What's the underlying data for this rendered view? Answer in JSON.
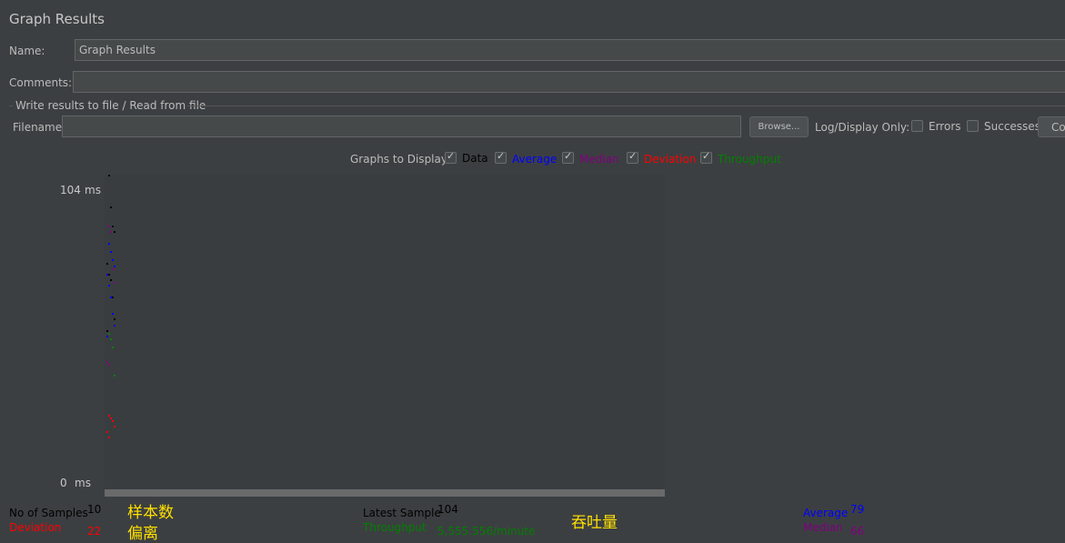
{
  "header": {
    "title": "Graph Results"
  },
  "name_field": {
    "label": "Name:",
    "value": "Graph Results"
  },
  "comments_field": {
    "label": "Comments:",
    "value": ""
  },
  "file_group": {
    "title": "Write results to file / Read from file",
    "filename_label": "Filename",
    "filename_value": "",
    "browse_label": "Browse...",
    "log_display_label": "Log/Display Only:",
    "errors_label": "Errors",
    "successes_label": "Successes",
    "configure_label": "Co"
  },
  "graphs": {
    "label": "Graphs to Display",
    "options": [
      {
        "label": "Data",
        "checked": true,
        "color": "#000000"
      },
      {
        "label": "Average",
        "checked": true,
        "color": "#0000ff"
      },
      {
        "label": "Median",
        "checked": true,
        "color": "#800080"
      },
      {
        "label": "Deviation",
        "checked": true,
        "color": "#ff0000"
      },
      {
        "label": "Throughput",
        "checked": true,
        "color": "#008000"
      }
    ]
  },
  "chart_data": {
    "type": "scatter",
    "ylabel_top": "104",
    "ylabel_bottom": "0",
    "y_unit": "ms",
    "ylim": [
      0,
      104
    ],
    "series": [
      {
        "name": "Data",
        "color": "#000000",
        "points": [
          [
            1,
            110
          ],
          [
            2,
            98
          ],
          [
            3,
            91
          ],
          [
            4,
            89
          ],
          [
            5,
            78
          ],
          [
            6,
            74
          ],
          [
            7,
            72
          ],
          [
            8,
            66
          ],
          [
            9,
            58
          ],
          [
            10,
            54
          ]
        ]
      },
      {
        "name": "Average",
        "color": "#0000ff",
        "points": [
          [
            1,
            85
          ],
          [
            2,
            82
          ],
          [
            3,
            79
          ],
          [
            4,
            77
          ],
          [
            5,
            74
          ],
          [
            6,
            70
          ],
          [
            7,
            66
          ],
          [
            8,
            60
          ],
          [
            9,
            56
          ],
          [
            10,
            52
          ]
        ]
      },
      {
        "name": "Median",
        "color": "#800080",
        "points": [
          [
            1,
            91
          ],
          [
            2,
            89
          ],
          [
            3,
            76
          ],
          [
            4,
            71
          ],
          [
            5,
            43
          ],
          [
            6,
            42
          ]
        ]
      },
      {
        "name": "Deviation",
        "color": "#ff0000",
        "points": [
          [
            1,
            24
          ],
          [
            2,
            23
          ],
          [
            3,
            22
          ],
          [
            4,
            20
          ],
          [
            5,
            18
          ],
          [
            6,
            16
          ]
        ]
      },
      {
        "name": "Throughput",
        "color": "#008000",
        "points": [
          [
            1,
            53
          ],
          [
            2,
            51
          ],
          [
            3,
            48
          ],
          [
            4,
            38
          ]
        ]
      }
    ]
  },
  "stats": {
    "samples_label": "No of Samples",
    "samples_value": "10",
    "deviation_label": "Deviation",
    "deviation_value": "22",
    "latest_label": "Latest Sample",
    "latest_value": "104",
    "throughput_label": "Throughput",
    "throughput_value": "5,555.556/minute",
    "average_label": "Average",
    "average_value": "79",
    "median_label": "Median",
    "median_value": "66"
  },
  "annotations": {
    "samples_cn": "样本数",
    "deviation_cn": "偏离",
    "throughput_cn": "吞吐量"
  }
}
